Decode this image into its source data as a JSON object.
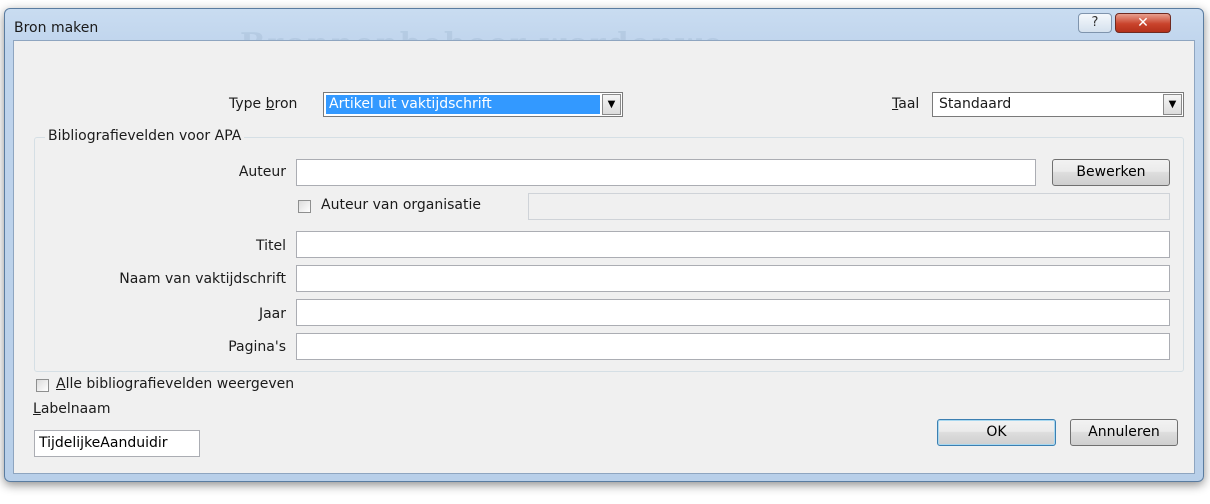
{
  "window": {
    "title": "Bron maken",
    "ghost_title": "Bronnenbeheer wordenwe",
    "help_glyph": "?",
    "close_glyph": "✕"
  },
  "type_bron": {
    "label_pre": "Type ",
    "label_accel": "b",
    "label_post": "ron",
    "value": "Artikel uit vaktijdschrift",
    "arrow": "▼"
  },
  "taal": {
    "label_accel": "T",
    "label_post": "aal",
    "value": "Standaard",
    "arrow": "▼"
  },
  "group": {
    "legend": "Bibliografievelden voor APA",
    "auteur_label": "Auteur",
    "auteur_value": "",
    "bewerken_button": "Bewerken",
    "org_checkbox_label": "Auteur van organisatie",
    "org_checked": false,
    "org_value": "",
    "titel_label": "Titel",
    "titel_value": "",
    "vaktijdschrift_label": "Naam van vaktijdschrift",
    "vaktijdschrift_value": "",
    "jaar_label": "Jaar",
    "jaar_value": "",
    "paginas_label": "Pagina's",
    "paginas_value": ""
  },
  "show_all": {
    "label_accel": "A",
    "label_post": "lle bibliografievelden weergeven",
    "checked": false
  },
  "labelnaam": {
    "label_accel": "L",
    "label_post": "abelnaam",
    "value": "TijdelijkeAanduidir"
  },
  "buttons": {
    "ok": "OK",
    "cancel": "Annuleren"
  }
}
